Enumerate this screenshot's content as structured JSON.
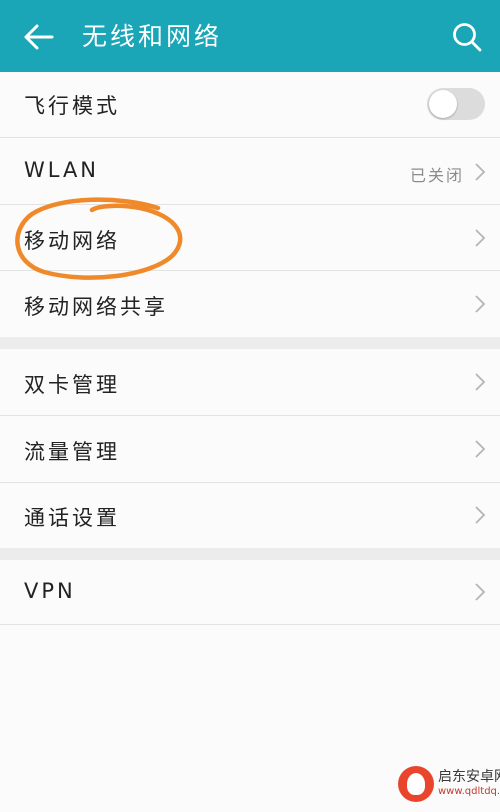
{
  "header": {
    "title": "无线和网络",
    "back_icon": "arrow-left-icon",
    "search_icon": "search-icon",
    "background": "#1aa6b6"
  },
  "settings": {
    "airplane_mode": {
      "label": "飞行模式",
      "toggle_on": false
    },
    "wlan": {
      "label": "WLAN",
      "value": "已关闭"
    },
    "mobile_network": {
      "label": "移动网络",
      "highlighted": true
    },
    "tethering": {
      "label": "移动网络共享"
    },
    "dual_sim": {
      "label": "双卡管理"
    },
    "data_usage": {
      "label": "流量管理"
    },
    "call_settings": {
      "label": "通话设置"
    },
    "vpn": {
      "label": "VPN"
    }
  },
  "annotation": {
    "color": "#f0892a",
    "shape": "hand-drawn-circle"
  },
  "watermark": {
    "title": "启东安卓网",
    "url": "www.qdltdq.com"
  }
}
